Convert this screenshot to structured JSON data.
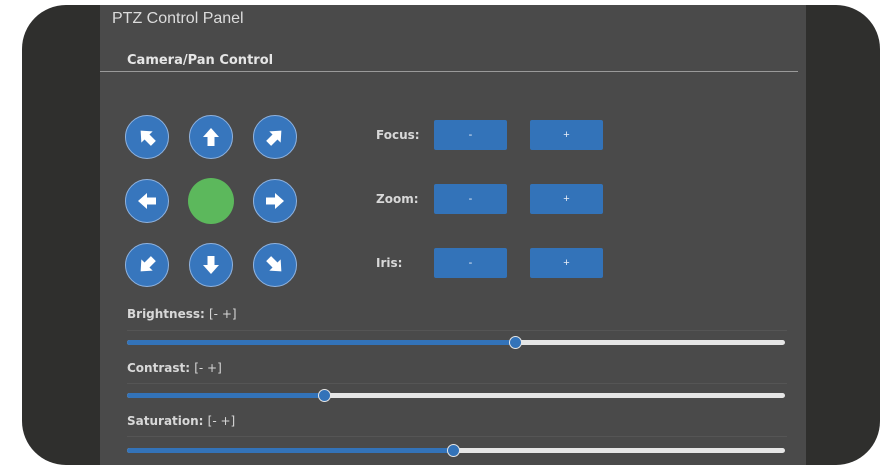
{
  "panel": {
    "title": "PTZ Control Panel",
    "section_title": "Camera/Pan Control"
  },
  "pan": {
    "up_left_icon": "arrow-up-left-icon",
    "up_icon": "arrow-up-icon",
    "up_right_icon": "arrow-up-right-icon",
    "left_icon": "arrow-left-icon",
    "home_color": "#5cb85c",
    "right_icon": "arrow-right-icon",
    "down_left_icon": "arrow-down-left-icon",
    "down_icon": "arrow-down-icon",
    "down_right_icon": "arrow-down-right-icon"
  },
  "lens": {
    "focus": {
      "label": "Focus:",
      "minus": "-",
      "plus": "+"
    },
    "zoom": {
      "label": "Zoom:",
      "minus": "-",
      "plus": "+"
    },
    "iris": {
      "label": "Iris:",
      "minus": "-",
      "plus": "+"
    }
  },
  "sliders": {
    "brightness": {
      "label": "Brightness:",
      "adjust": "[- +]",
      "value": 0.59
    },
    "contrast": {
      "label": "Contrast:",
      "adjust": "[- +]",
      "value": 0.3
    },
    "saturation": {
      "label": "Saturation:",
      "adjust": "[- +]",
      "value": 0.496
    }
  },
  "colors": {
    "accent": "#3373b9",
    "panel_bg": "#4a4a4a",
    "bezel": "#2f2f2d"
  }
}
